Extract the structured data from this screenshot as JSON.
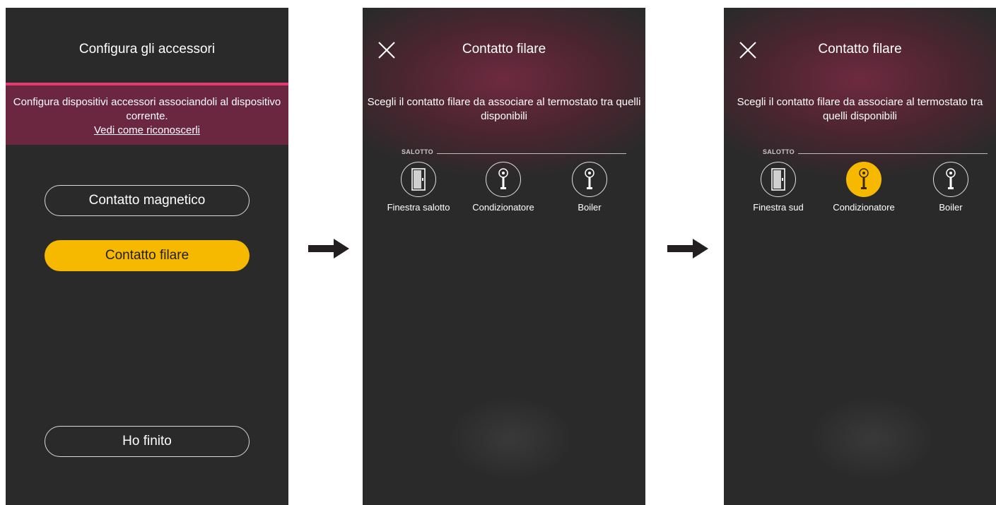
{
  "screen1": {
    "title": "Configura gli accessori",
    "banner_text": "Configura dispositivi accessori associandoli al dispositivo corrente.",
    "banner_link": "Vedi come riconoscerli",
    "buttons": {
      "magnetico": "Contatto magnetico",
      "filare": "Contatto filare",
      "finito": "Ho finito"
    }
  },
  "screen2": {
    "title": "Contatto filare",
    "instruction": "Scegli il contatto filare da associare al termostato tra quelli disponibili",
    "section": "SALOTTO",
    "devices": [
      {
        "label": "Finestra salotto",
        "icon": "door-icon",
        "selected": false
      },
      {
        "label": "Condizionatore",
        "icon": "wired-contact-icon",
        "selected": false
      },
      {
        "label": "Boiler",
        "icon": "wired-contact-icon",
        "selected": false
      }
    ]
  },
  "screen3": {
    "title": "Contatto filare",
    "instruction": "Scegli il contatto filare da associare al termostato tra quelli disponibili",
    "section": "SALOTTO",
    "devices": [
      {
        "label": "Finestra sud",
        "icon": "door-icon",
        "selected": false
      },
      {
        "label": "Condizionatore",
        "icon": "wired-contact-icon",
        "selected": true
      },
      {
        "label": "Boiler",
        "icon": "wired-contact-icon",
        "selected": false
      }
    ]
  },
  "colors": {
    "accent": "#f7b800",
    "banner": "#6b2740",
    "pink_line": "#e63a6e",
    "background": "#2a2a2a"
  },
  "arrows": [
    "arrow-right-icon",
    "arrow-right-icon"
  ]
}
